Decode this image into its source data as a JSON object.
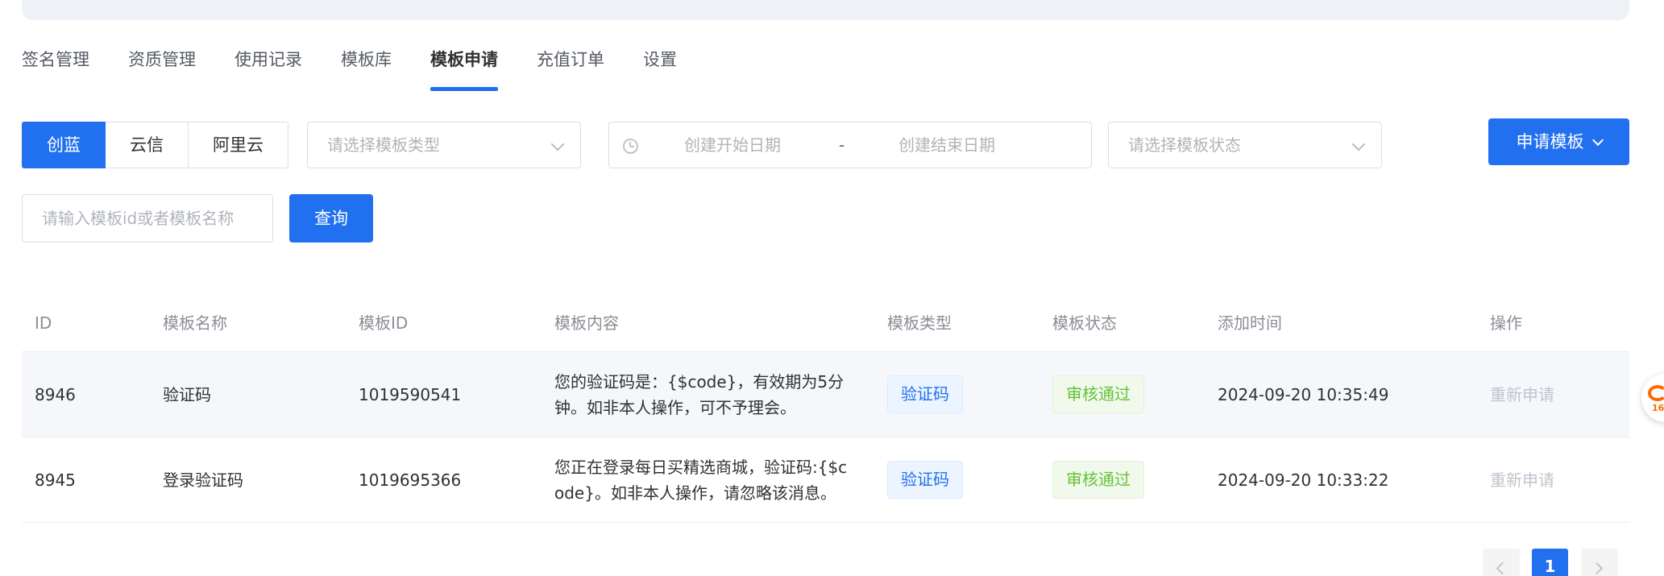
{
  "tabs": [
    {
      "label": "签名管理",
      "active": false
    },
    {
      "label": "资质管理",
      "active": false
    },
    {
      "label": "使用记录",
      "active": false
    },
    {
      "label": "模板库",
      "active": false
    },
    {
      "label": "模板申请",
      "active": true
    },
    {
      "label": "充值订单",
      "active": false
    },
    {
      "label": "设置",
      "active": false
    }
  ],
  "providers": [
    {
      "label": "创蓝",
      "active": true
    },
    {
      "label": "云信",
      "active": false
    },
    {
      "label": "阿里云",
      "active": false
    }
  ],
  "filters": {
    "template_type_placeholder": "请选择模板类型",
    "date_start_placeholder": "创建开始日期",
    "date_separator": "-",
    "date_end_placeholder": "创建结束日期",
    "status_placeholder": "请选择模板状态",
    "search_placeholder": "请输入模板id或者模板名称",
    "search_value": "",
    "query_label": "查询",
    "apply_label": "申请模板"
  },
  "table": {
    "columns": [
      "ID",
      "模板名称",
      "模板ID",
      "模板内容",
      "模板类型",
      "模板状态",
      "添加时间",
      "操作"
    ],
    "rows": [
      {
        "id": "8946",
        "name": "验证码",
        "template_id": "1019590541",
        "content": "您的验证码是：{$code}，有效期为5分钟。如非本人操作，可不予理会。",
        "type": "验证码",
        "status": "审核通过",
        "added": "2024-09-20 10:35:49",
        "action": "重新申请"
      },
      {
        "id": "8945",
        "name": "登录验证码",
        "template_id": "1019695366",
        "content": "您正在登录每日买精选商城，验证码:{$code}。如非本人操作，请忽略该消息。",
        "type": "验证码",
        "status": "审核通过",
        "added": "2024-09-20 10:33:22",
        "action": "重新申请"
      }
    ]
  },
  "pagination": {
    "current_page": "1"
  },
  "floating_badge": {
    "label": "16"
  },
  "colors": {
    "primary": "#2170f0",
    "success": "#67c23a",
    "border": "#dcdfe6",
    "muted": "#c0c4cc"
  }
}
